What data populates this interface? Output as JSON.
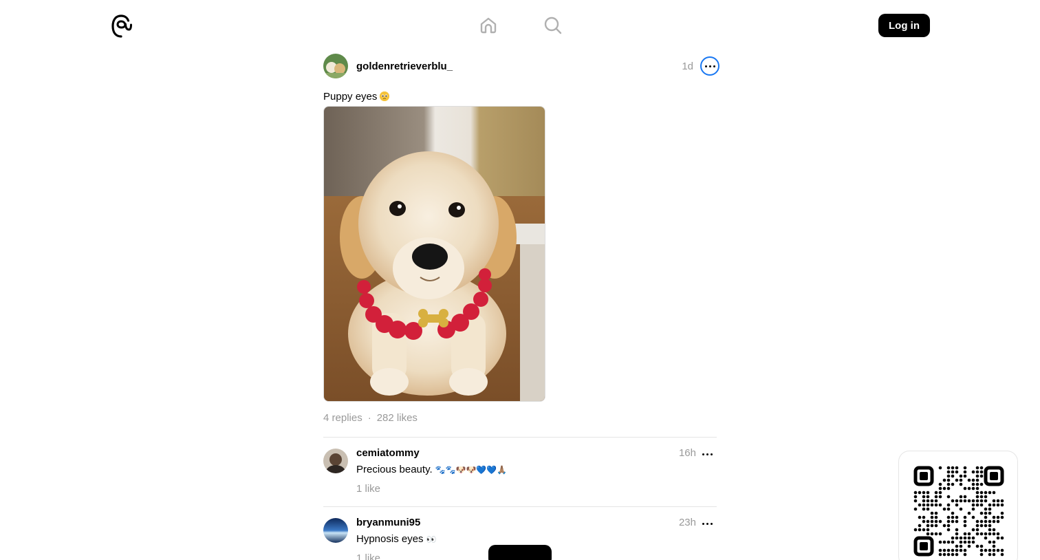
{
  "header": {
    "logo_icon": "threads-logo-icon",
    "nav": [
      {
        "icon": "home-icon"
      },
      {
        "icon": "search-icon"
      }
    ],
    "login_label": "Log in"
  },
  "post": {
    "username": "goldenretrieverblu_",
    "time": "1d",
    "caption": "Puppy eyes",
    "caption_emoji": "pleading-face-emoji",
    "replies": "4 replies",
    "separator": "·",
    "likes": "282 likes"
  },
  "replies": [
    {
      "username": "cemiatommy",
      "time": "16h",
      "text": "Precious beauty.",
      "emoji": "🐾🐾🐶🐶💙💙🙏🏽",
      "likes": "1 like"
    },
    {
      "username": "bryanmuni95",
      "time": "23h",
      "text": "Hypnosis eyes",
      "emoji": "👀",
      "likes": "1 like"
    }
  ],
  "colors": {
    "accent": "#1877f2",
    "muted": "#999999",
    "divider": "#e5e5e5"
  }
}
